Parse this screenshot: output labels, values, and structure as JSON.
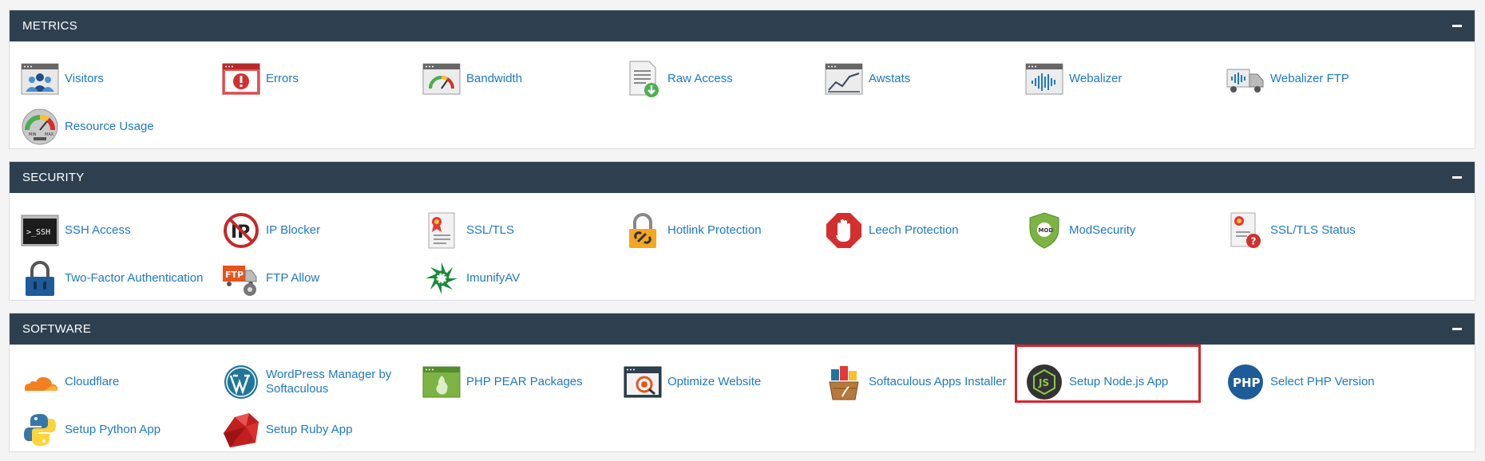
{
  "sections": [
    {
      "title": "METRICS",
      "items": [
        {
          "label": "Visitors",
          "icon": "visitors-icon"
        },
        {
          "label": "Errors",
          "icon": "errors-icon"
        },
        {
          "label": "Bandwidth",
          "icon": "bandwidth-icon"
        },
        {
          "label": "Raw Access",
          "icon": "raw-access-icon"
        },
        {
          "label": "Awstats",
          "icon": "awstats-icon"
        },
        {
          "label": "Webalizer",
          "icon": "webalizer-icon"
        },
        {
          "label": "Webalizer FTP",
          "icon": "webalizer-ftp-icon"
        },
        {
          "label": "Resource Usage",
          "icon": "resource-usage-icon",
          "gauge_text_min": "MIN",
          "gauge_text_max": "MAX"
        }
      ]
    },
    {
      "title": "SECURITY",
      "items": [
        {
          "label": "SSH Access",
          "icon": "ssh-icon",
          "icon_text": ">_SSH"
        },
        {
          "label": "IP Blocker",
          "icon": "ip-blocker-icon",
          "icon_text": "IP"
        },
        {
          "label": "SSL/TLS",
          "icon": "ssl-certificate-icon"
        },
        {
          "label": "Hotlink Protection",
          "icon": "padlock-link-icon"
        },
        {
          "label": "Leech Protection",
          "icon": "stop-hand-icon"
        },
        {
          "label": "ModSecurity",
          "icon": "shield-icon",
          "icon_text": "MOD"
        },
        {
          "label": "SSL/TLS Status",
          "icon": "ssl-status-icon"
        },
        {
          "label": "Two-Factor Authentication",
          "icon": "padlock-icon"
        },
        {
          "label": "FTP Allow",
          "icon": "ftp-truck-icon",
          "icon_text": "FTP"
        },
        {
          "label": "ImunifyAV",
          "icon": "imunify-icon"
        }
      ]
    },
    {
      "title": "SOFTWARE",
      "items": [
        {
          "label": "Cloudflare",
          "icon": "cloud-icon"
        },
        {
          "label": "WordPress Manager by Softaculous",
          "icon": "wordpress-icon"
        },
        {
          "label": "PHP PEAR Packages",
          "icon": "pear-icon"
        },
        {
          "label": "Optimize Website",
          "icon": "optimize-icon"
        },
        {
          "label": "Softaculous Apps Installer",
          "icon": "softaculous-icon"
        },
        {
          "label": "Setup Node.js App",
          "icon": "nodejs-icon",
          "icon_text": "JS"
        },
        {
          "label": "Select PHP Version",
          "icon": "php-icon",
          "icon_text": "PHP"
        },
        {
          "label": "Setup Python App",
          "icon": "python-icon"
        },
        {
          "label": "Setup Ruby App",
          "icon": "ruby-icon"
        }
      ]
    }
  ],
  "colors": {
    "header_bg": "#2e4050",
    "link": "#1f79c2",
    "highlight": "#d9252b"
  }
}
